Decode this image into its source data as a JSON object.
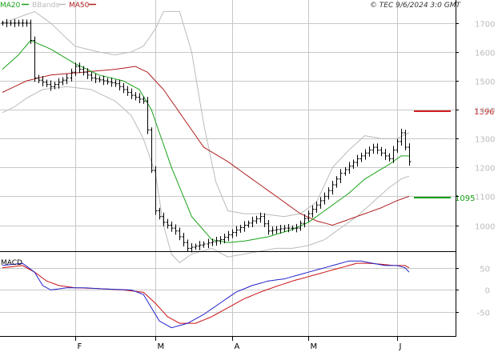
{
  "legend": {
    "ma20_label": "MA20",
    "bbands_label": "BBands",
    "ma50_label": "MA50"
  },
  "copyright": "© TEC 9/6/2024 3:0 GMT",
  "macd_label": "MACD",
  "colors": {
    "ma20": "#1aa31a",
    "bbands": "#bbbbbb",
    "ma50": "#b01e1e",
    "price_bars": "#000000",
    "grid": "#c8c8c8",
    "resistance": "#d42020",
    "support": "#10a010",
    "macd_line": "#2222cc",
    "signal_line": "#cc1111"
  },
  "chart_data": [
    {
      "type": "ohlc",
      "y_ticks": [
        1000,
        1100,
        1200,
        1300,
        1400,
        1500,
        1600,
        1700
      ],
      "y_tick_labels": [
        "1000",
        "1100",
        "1200",
        "1300",
        "1400",
        "1500",
        "1600",
        "1700"
      ],
      "ylim": [
        910,
        1780
      ],
      "x_months": [
        "F",
        "M",
        "A",
        "M",
        "J"
      ],
      "month_start_index": [
        18,
        38,
        57,
        76,
        98
      ],
      "n_days": 103,
      "levels": [
        {
          "name": "resistance",
          "value": 1396,
          "label": "1396"
        },
        {
          "name": "support",
          "value": 1095,
          "label": "1095"
        }
      ],
      "close_points": [
        [
          0,
          1700
        ],
        [
          3,
          1700
        ],
        [
          6,
          1700
        ],
        [
          7,
          1640
        ],
        [
          8,
          1510
        ],
        [
          12,
          1480
        ],
        [
          16,
          1510
        ],
        [
          18,
          1550
        ],
        [
          22,
          1510
        ],
        [
          28,
          1490
        ],
        [
          32,
          1450
        ],
        [
          35,
          1430
        ],
        [
          36,
          1330
        ],
        [
          38,
          1050
        ],
        [
          40,
          1010
        ],
        [
          43,
          980
        ],
        [
          46,
          920
        ],
        [
          50,
          935
        ],
        [
          54,
          950
        ],
        [
          60,
          1000
        ],
        [
          64,
          1030
        ],
        [
          66,
          980
        ],
        [
          70,
          990
        ],
        [
          73,
          990
        ],
        [
          76,
          1040
        ],
        [
          80,
          1100
        ],
        [
          84,
          1180
        ],
        [
          88,
          1230
        ],
        [
          92,
          1270
        ],
        [
          96,
          1230
        ],
        [
          98,
          1290
        ],
        [
          99,
          1320
        ],
        [
          100,
          1270
        ],
        [
          101,
          1220
        ]
      ],
      "ma20_points": [
        [
          0,
          1540
        ],
        [
          4,
          1590
        ],
        [
          7,
          1640
        ],
        [
          12,
          1610
        ],
        [
          18,
          1560
        ],
        [
          24,
          1520
        ],
        [
          30,
          1500
        ],
        [
          34,
          1470
        ],
        [
          37,
          1400
        ],
        [
          42,
          1200
        ],
        [
          47,
          1030
        ],
        [
          52,
          950
        ],
        [
          56,
          940
        ],
        [
          60,
          945
        ],
        [
          66,
          960
        ],
        [
          72,
          985
        ],
        [
          76,
          1010
        ],
        [
          80,
          1050
        ],
        [
          86,
          1110
        ],
        [
          90,
          1160
        ],
        [
          96,
          1210
        ],
        [
          99,
          1240
        ],
        [
          101,
          1240
        ]
      ],
      "ma50_points": [
        [
          0,
          1460
        ],
        [
          6,
          1500
        ],
        [
          12,
          1520
        ],
        [
          20,
          1530
        ],
        [
          28,
          1540
        ],
        [
          33,
          1550
        ],
        [
          36,
          1530
        ],
        [
          40,
          1470
        ],
        [
          44,
          1390
        ],
        [
          50,
          1270
        ],
        [
          56,
          1220
        ],
        [
          62,
          1160
        ],
        [
          68,
          1100
        ],
        [
          74,
          1040
        ],
        [
          78,
          1015
        ],
        [
          82,
          1000
        ],
        [
          86,
          1020
        ],
        [
          90,
          1040
        ],
        [
          94,
          1060
        ],
        [
          98,
          1085
        ],
        [
          101,
          1100
        ]
      ],
      "bb_upper_points": [
        [
          0,
          1700
        ],
        [
          4,
          1720
        ],
        [
          8,
          1740
        ],
        [
          12,
          1700
        ],
        [
          18,
          1620
        ],
        [
          24,
          1600
        ],
        [
          28,
          1590
        ],
        [
          32,
          1600
        ],
        [
          35,
          1620
        ],
        [
          38,
          1680
        ],
        [
          40,
          1740
        ],
        [
          44,
          1740
        ],
        [
          47,
          1600
        ],
        [
          50,
          1350
        ],
        [
          53,
          1150
        ],
        [
          56,
          1050
        ],
        [
          60,
          1040
        ],
        [
          64,
          1040
        ],
        [
          70,
          1030
        ],
        [
          74,
          1040
        ],
        [
          78,
          1080
        ],
        [
          82,
          1200
        ],
        [
          86,
          1260
        ],
        [
          90,
          1310
        ],
        [
          94,
          1300
        ],
        [
          98,
          1300
        ],
        [
          101,
          1320
        ]
      ],
      "bb_lower_points": [
        [
          0,
          1390
        ],
        [
          3,
          1410
        ],
        [
          6,
          1440
        ],
        [
          10,
          1470
        ],
        [
          16,
          1480
        ],
        [
          22,
          1470
        ],
        [
          28,
          1430
        ],
        [
          32,
          1380
        ],
        [
          35,
          1300
        ],
        [
          38,
          1180
        ],
        [
          40,
          1000
        ],
        [
          42,
          900
        ],
        [
          44,
          870
        ],
        [
          47,
          900
        ],
        [
          52,
          920
        ],
        [
          56,
          890
        ],
        [
          60,
          900
        ],
        [
          64,
          910
        ],
        [
          68,
          920
        ],
        [
          72,
          920
        ],
        [
          76,
          930
        ],
        [
          80,
          950
        ],
        [
          84,
          990
        ],
        [
          88,
          1030
        ],
        [
          92,
          1080
        ],
        [
          96,
          1130
        ],
        [
          99,
          1160
        ],
        [
          101,
          1170
        ]
      ]
    },
    {
      "type": "line",
      "name": "MACD",
      "y_ticks": [
        50,
        0,
        -50
      ],
      "y_tick_labels": [
        "50",
        "0",
        "-50"
      ],
      "ylim": [
        -100,
        80
      ],
      "macd_points": [
        [
          0,
          55
        ],
        [
          5,
          60
        ],
        [
          8,
          40
        ],
        [
          10,
          10
        ],
        [
          12,
          0
        ],
        [
          16,
          5
        ],
        [
          20,
          5
        ],
        [
          26,
          2
        ],
        [
          32,
          0
        ],
        [
          35,
          -10
        ],
        [
          37,
          -40
        ],
        [
          39,
          -70
        ],
        [
          42,
          -85
        ],
        [
          46,
          -75
        ],
        [
          50,
          -55
        ],
        [
          54,
          -30
        ],
        [
          58,
          -5
        ],
        [
          62,
          10
        ],
        [
          66,
          20
        ],
        [
          70,
          25
        ],
        [
          74,
          35
        ],
        [
          78,
          45
        ],
        [
          82,
          55
        ],
        [
          86,
          65
        ],
        [
          89,
          65
        ],
        [
          92,
          60
        ],
        [
          95,
          55
        ],
        [
          98,
          55
        ],
        [
          100,
          50
        ],
        [
          101,
          40
        ]
      ],
      "signal_points": [
        [
          0,
          50
        ],
        [
          5,
          55
        ],
        [
          8,
          40
        ],
        [
          11,
          20
        ],
        [
          14,
          10
        ],
        [
          18,
          5
        ],
        [
          24,
          3
        ],
        [
          30,
          0
        ],
        [
          35,
          -5
        ],
        [
          38,
          -30
        ],
        [
          41,
          -60
        ],
        [
          44,
          -75
        ],
        [
          48,
          -75
        ],
        [
          52,
          -60
        ],
        [
          56,
          -40
        ],
        [
          60,
          -20
        ],
        [
          64,
          -5
        ],
        [
          68,
          8
        ],
        [
          72,
          20
        ],
        [
          76,
          30
        ],
        [
          80,
          40
        ],
        [
          84,
          50
        ],
        [
          88,
          60
        ],
        [
          91,
          60
        ],
        [
          94,
          58
        ],
        [
          97,
          55
        ],
        [
          100,
          55
        ],
        [
          101,
          50
        ]
      ]
    }
  ]
}
